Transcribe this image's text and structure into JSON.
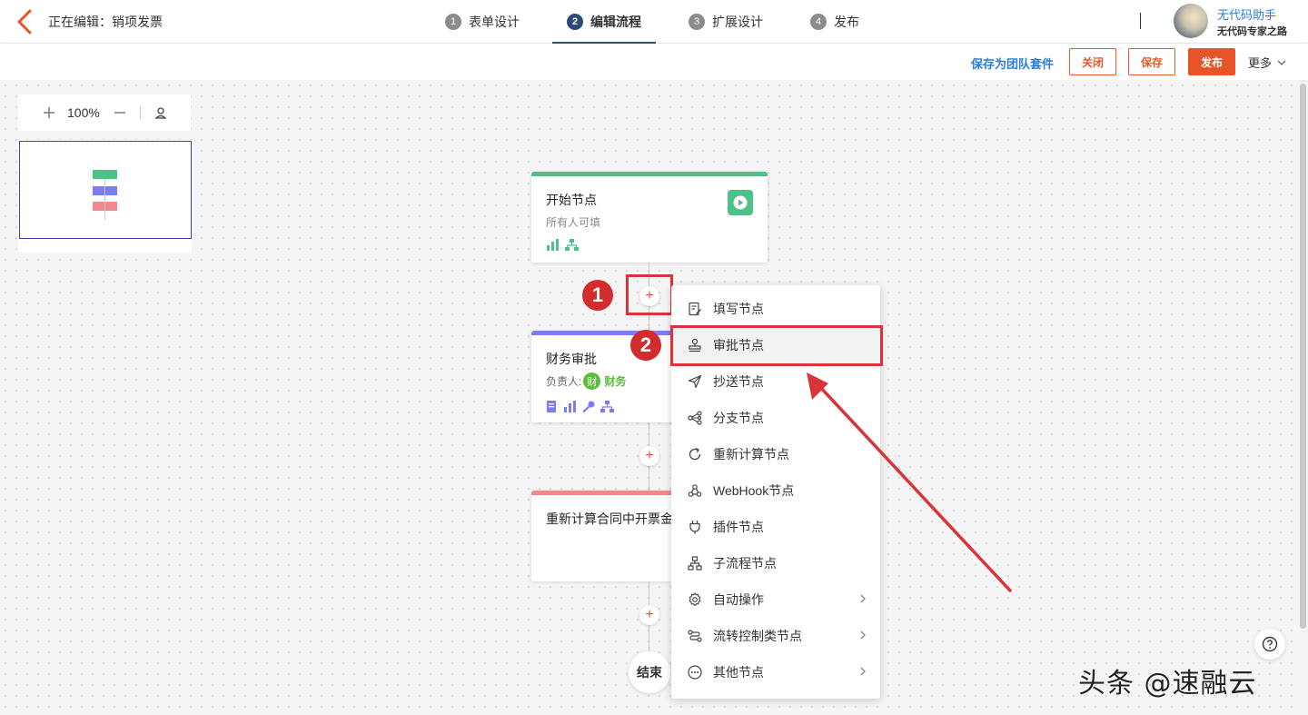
{
  "header": {
    "editing_label": "正在编辑：",
    "form_name": "销项发票",
    "steps": [
      {
        "num": "1",
        "label": "表单设计"
      },
      {
        "num": "2",
        "label": "编辑流程"
      },
      {
        "num": "3",
        "label": "扩展设计"
      },
      {
        "num": "4",
        "label": "发布"
      }
    ],
    "active_step": "2",
    "user_name": "无代码助手",
    "user_sub": "无代码专家之路"
  },
  "actions": {
    "save_suite": "保存为团队套件",
    "close": "关闭",
    "save": "保存",
    "publish": "发布",
    "more": "更多"
  },
  "zoom": {
    "plus": "+",
    "value": "100%",
    "minus": "—"
  },
  "flow": {
    "start_node": {
      "title": "开始节点",
      "sub": "所有人可填"
    },
    "approve_node": {
      "title": "财务审批",
      "owner_label": "负责人:",
      "owner_badge": "财",
      "owner_name": "财务"
    },
    "recalc_node": {
      "title": "重新计算合同中开票金"
    },
    "plus_symbol": "+",
    "end": "结束"
  },
  "annotations": {
    "marker_1": "1",
    "marker_2": "2"
  },
  "menu": {
    "items": [
      {
        "label": "填写节点",
        "icon": "form-edit-icon",
        "submenu": false
      },
      {
        "label": "审批节点",
        "icon": "stamp-icon",
        "submenu": false
      },
      {
        "label": "抄送节点",
        "icon": "send-icon",
        "submenu": false
      },
      {
        "label": "分支节点",
        "icon": "branch-icon",
        "submenu": false
      },
      {
        "label": "重新计算节点",
        "icon": "refresh-icon",
        "submenu": false
      },
      {
        "label": "WebHook节点",
        "icon": "webhook-icon",
        "submenu": false
      },
      {
        "label": "插件节点",
        "icon": "plug-icon",
        "submenu": false
      },
      {
        "label": "子流程节点",
        "icon": "subflow-icon",
        "submenu": false
      },
      {
        "label": "自动操作",
        "icon": "gear-icon",
        "submenu": true
      },
      {
        "label": "流转控制类节点",
        "icon": "flow-control-icon",
        "submenu": true
      },
      {
        "label": "其他节点",
        "icon": "more-dots-icon",
        "submenu": true
      }
    ]
  },
  "watermark": "头条 @速融云",
  "colors": {
    "accent": "#e8542a",
    "active_step": "#2b4a76",
    "link": "#2b7dd9",
    "start_bar": "#4cc28a",
    "approve_bar": "#7a7cf0",
    "recalc_bar": "#f08a8f",
    "annotation": "#d9343a"
  }
}
